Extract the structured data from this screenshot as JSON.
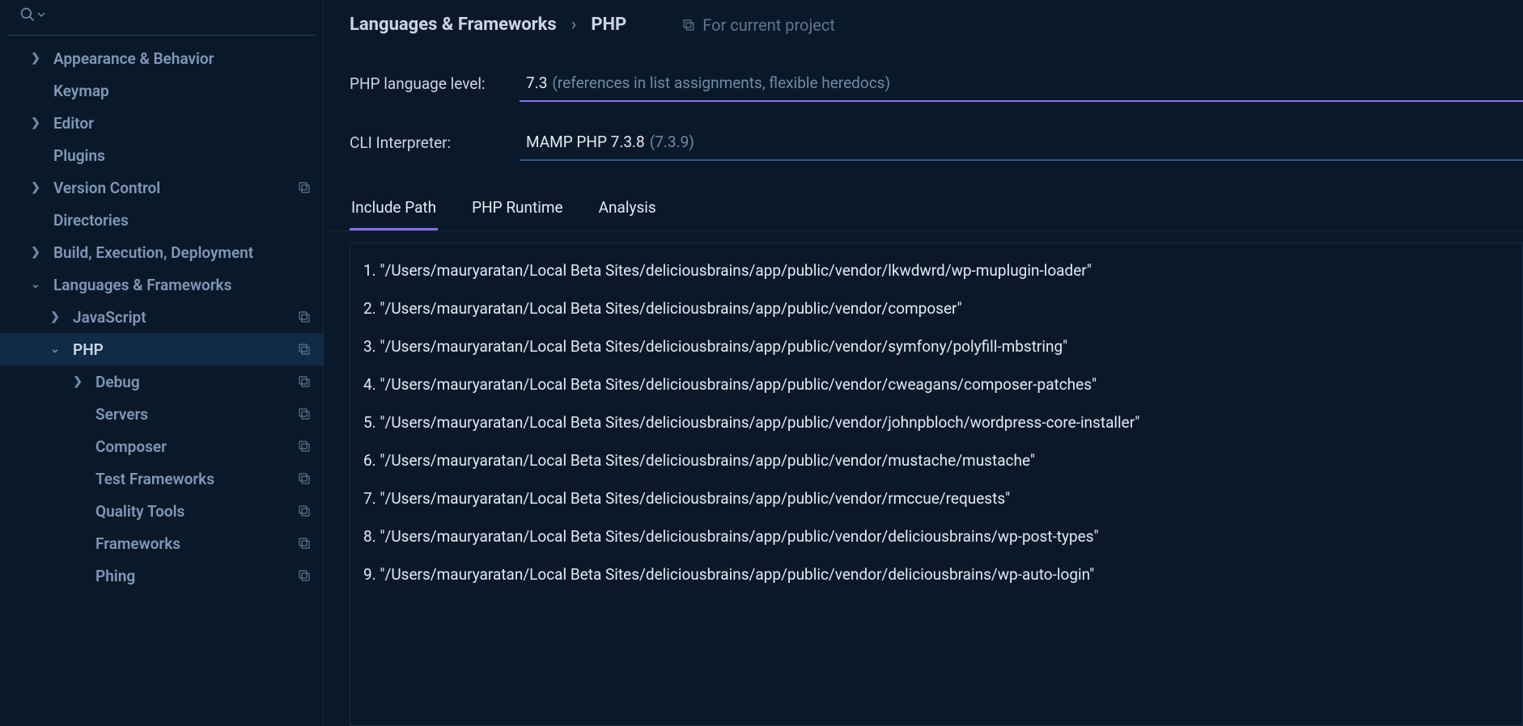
{
  "breadcrumb": {
    "parent": "Languages & Frameworks",
    "current": "PHP"
  },
  "projectScope": "For current project",
  "fields": {
    "languageLevel": {
      "label": "PHP language level:",
      "value": "7.3",
      "hint": "(references in list assignments, flexible heredocs)"
    },
    "cliInterpreter": {
      "label": "CLI Interpreter:",
      "value": "MAMP PHP 7.3.8",
      "hint": "(7.3.9)"
    }
  },
  "tabs": [
    {
      "label": "Include Path",
      "active": true
    },
    {
      "label": "PHP Runtime",
      "active": false
    },
    {
      "label": "Analysis",
      "active": false
    }
  ],
  "includePaths": [
    "1. \"/Users/mauryaratan/Local Beta Sites/deliciousbrains/app/public/vendor/lkwdwrd/wp-muplugin-loader\"",
    "2. \"/Users/mauryaratan/Local Beta Sites/deliciousbrains/app/public/vendor/composer\"",
    "3. \"/Users/mauryaratan/Local Beta Sites/deliciousbrains/app/public/vendor/symfony/polyfill-mbstring\"",
    "4. \"/Users/mauryaratan/Local Beta Sites/deliciousbrains/app/public/vendor/cweagans/composer-patches\"",
    "5. \"/Users/mauryaratan/Local Beta Sites/deliciousbrains/app/public/vendor/johnpbloch/wordpress-core-installer\"",
    "6. \"/Users/mauryaratan/Local Beta Sites/deliciousbrains/app/public/vendor/mustache/mustache\"",
    "7. \"/Users/mauryaratan/Local Beta Sites/deliciousbrains/app/public/vendor/rmccue/requests\"",
    "8. \"/Users/mauryaratan/Local Beta Sites/deliciousbrains/app/public/vendor/deliciousbrains/wp-post-types\"",
    "9. \"/Users/mauryaratan/Local Beta Sites/deliciousbrains/app/public/vendor/deliciousbrains/wp-auto-login\""
  ],
  "sidebar": {
    "items": [
      {
        "label": "Appearance & Behavior",
        "level": 0,
        "arrow": "right",
        "proj": false
      },
      {
        "label": "Keymap",
        "level": 0,
        "arrow": "none",
        "proj": false
      },
      {
        "label": "Editor",
        "level": 0,
        "arrow": "right",
        "proj": false
      },
      {
        "label": "Plugins",
        "level": 0,
        "arrow": "none",
        "proj": false
      },
      {
        "label": "Version Control",
        "level": 0,
        "arrow": "right",
        "proj": true
      },
      {
        "label": "Directories",
        "level": 0,
        "arrow": "none",
        "proj": false
      },
      {
        "label": "Build, Execution, Deployment",
        "level": 0,
        "arrow": "right",
        "proj": false
      },
      {
        "label": "Languages & Frameworks",
        "level": 0,
        "arrow": "down",
        "proj": false
      },
      {
        "label": "JavaScript",
        "level": 1,
        "arrow": "right",
        "proj": true
      },
      {
        "label": "PHP",
        "level": 1,
        "arrow": "down",
        "proj": true,
        "selected": true
      },
      {
        "label": "Debug",
        "level": 2,
        "arrow": "right",
        "proj": true
      },
      {
        "label": "Servers",
        "level": 2,
        "arrow": "none",
        "proj": true
      },
      {
        "label": "Composer",
        "level": 2,
        "arrow": "none",
        "proj": true
      },
      {
        "label": "Test Frameworks",
        "level": 2,
        "arrow": "none",
        "proj": true
      },
      {
        "label": "Quality Tools",
        "level": 2,
        "arrow": "none",
        "proj": true
      },
      {
        "label": "Frameworks",
        "level": 2,
        "arrow": "none",
        "proj": true
      },
      {
        "label": "Phing",
        "level": 2,
        "arrow": "none",
        "proj": true
      }
    ]
  }
}
